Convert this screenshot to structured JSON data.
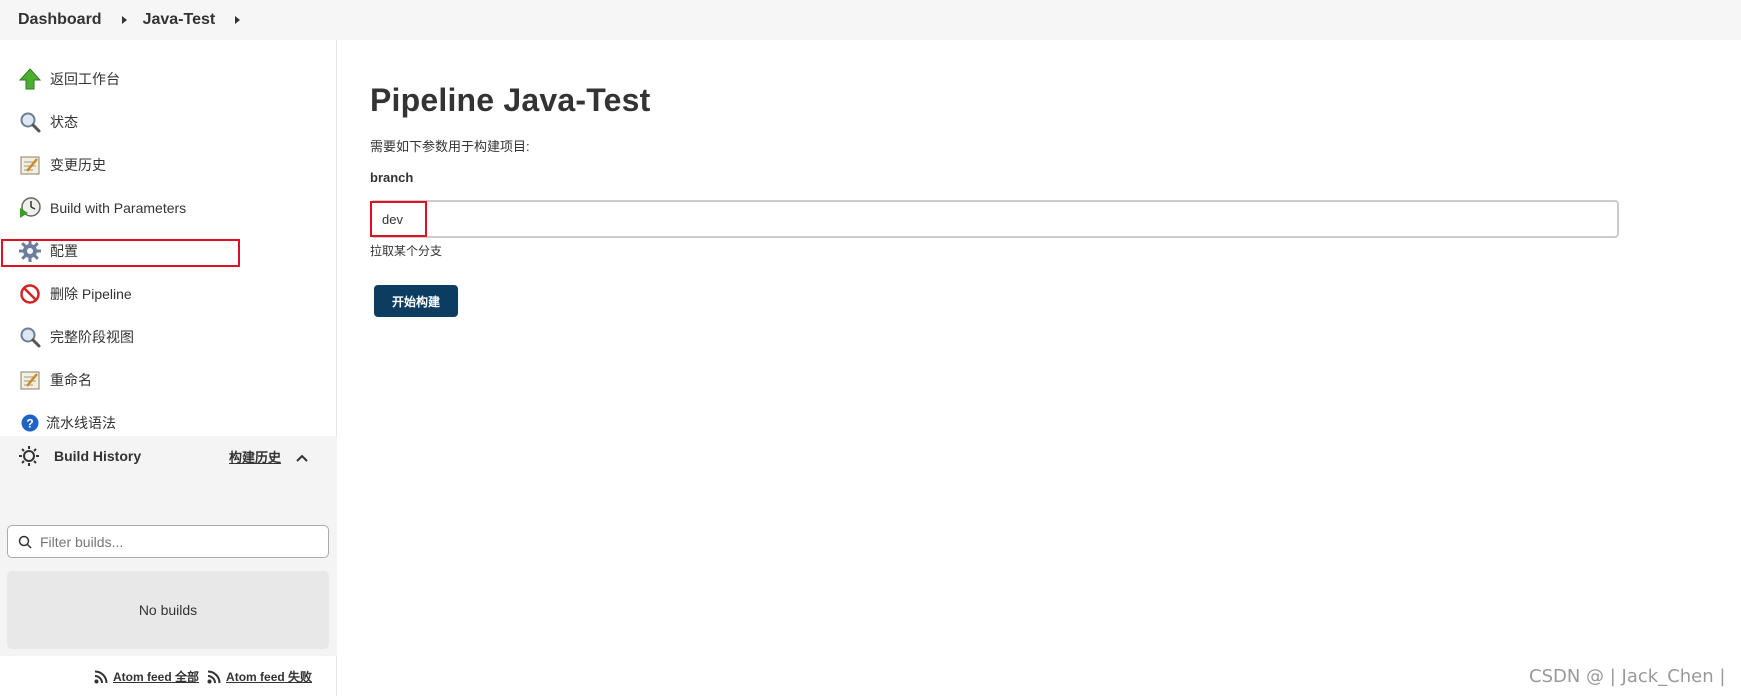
{
  "breadcrumb": {
    "items": [
      "Dashboard",
      "Java-Test"
    ]
  },
  "sidebar": {
    "items": [
      {
        "label": "返回工作台",
        "icon": "up-arrow-icon"
      },
      {
        "label": "状态",
        "icon": "search-icon"
      },
      {
        "label": "变更历史",
        "icon": "notepad-icon"
      },
      {
        "label": "Build with Parameters",
        "icon": "clock-play-icon"
      },
      {
        "label": "配置",
        "icon": "gear-icon"
      },
      {
        "label": "删除 Pipeline",
        "icon": "no-entry-icon"
      },
      {
        "label": "完整阶段视图",
        "icon": "search-icon"
      },
      {
        "label": "重命名",
        "icon": "notepad-icon"
      },
      {
        "label": "流水线语法",
        "icon": "help-icon"
      }
    ]
  },
  "build_history": {
    "title": "Build History",
    "link": "构建历史",
    "filter_placeholder": "Filter builds...",
    "empty_text": "No builds",
    "atom_all": {
      "label": "Atom feed",
      "suffix": "全部"
    },
    "atom_failed": {
      "label": "Atom feed",
      "suffix": "失败"
    }
  },
  "main": {
    "title": "Pipeline Java-Test",
    "description": "需要如下参数用于构建项目:",
    "param": {
      "name": "branch",
      "value": "dev",
      "help": "拉取某个分支"
    },
    "build_button": "开始构建"
  },
  "watermark": "CSDN @ | Jack_Chen |",
  "colors": {
    "highlight": "#e0101e",
    "button": "#0d3c61",
    "sidebar_bg": "#f4f4f4"
  }
}
